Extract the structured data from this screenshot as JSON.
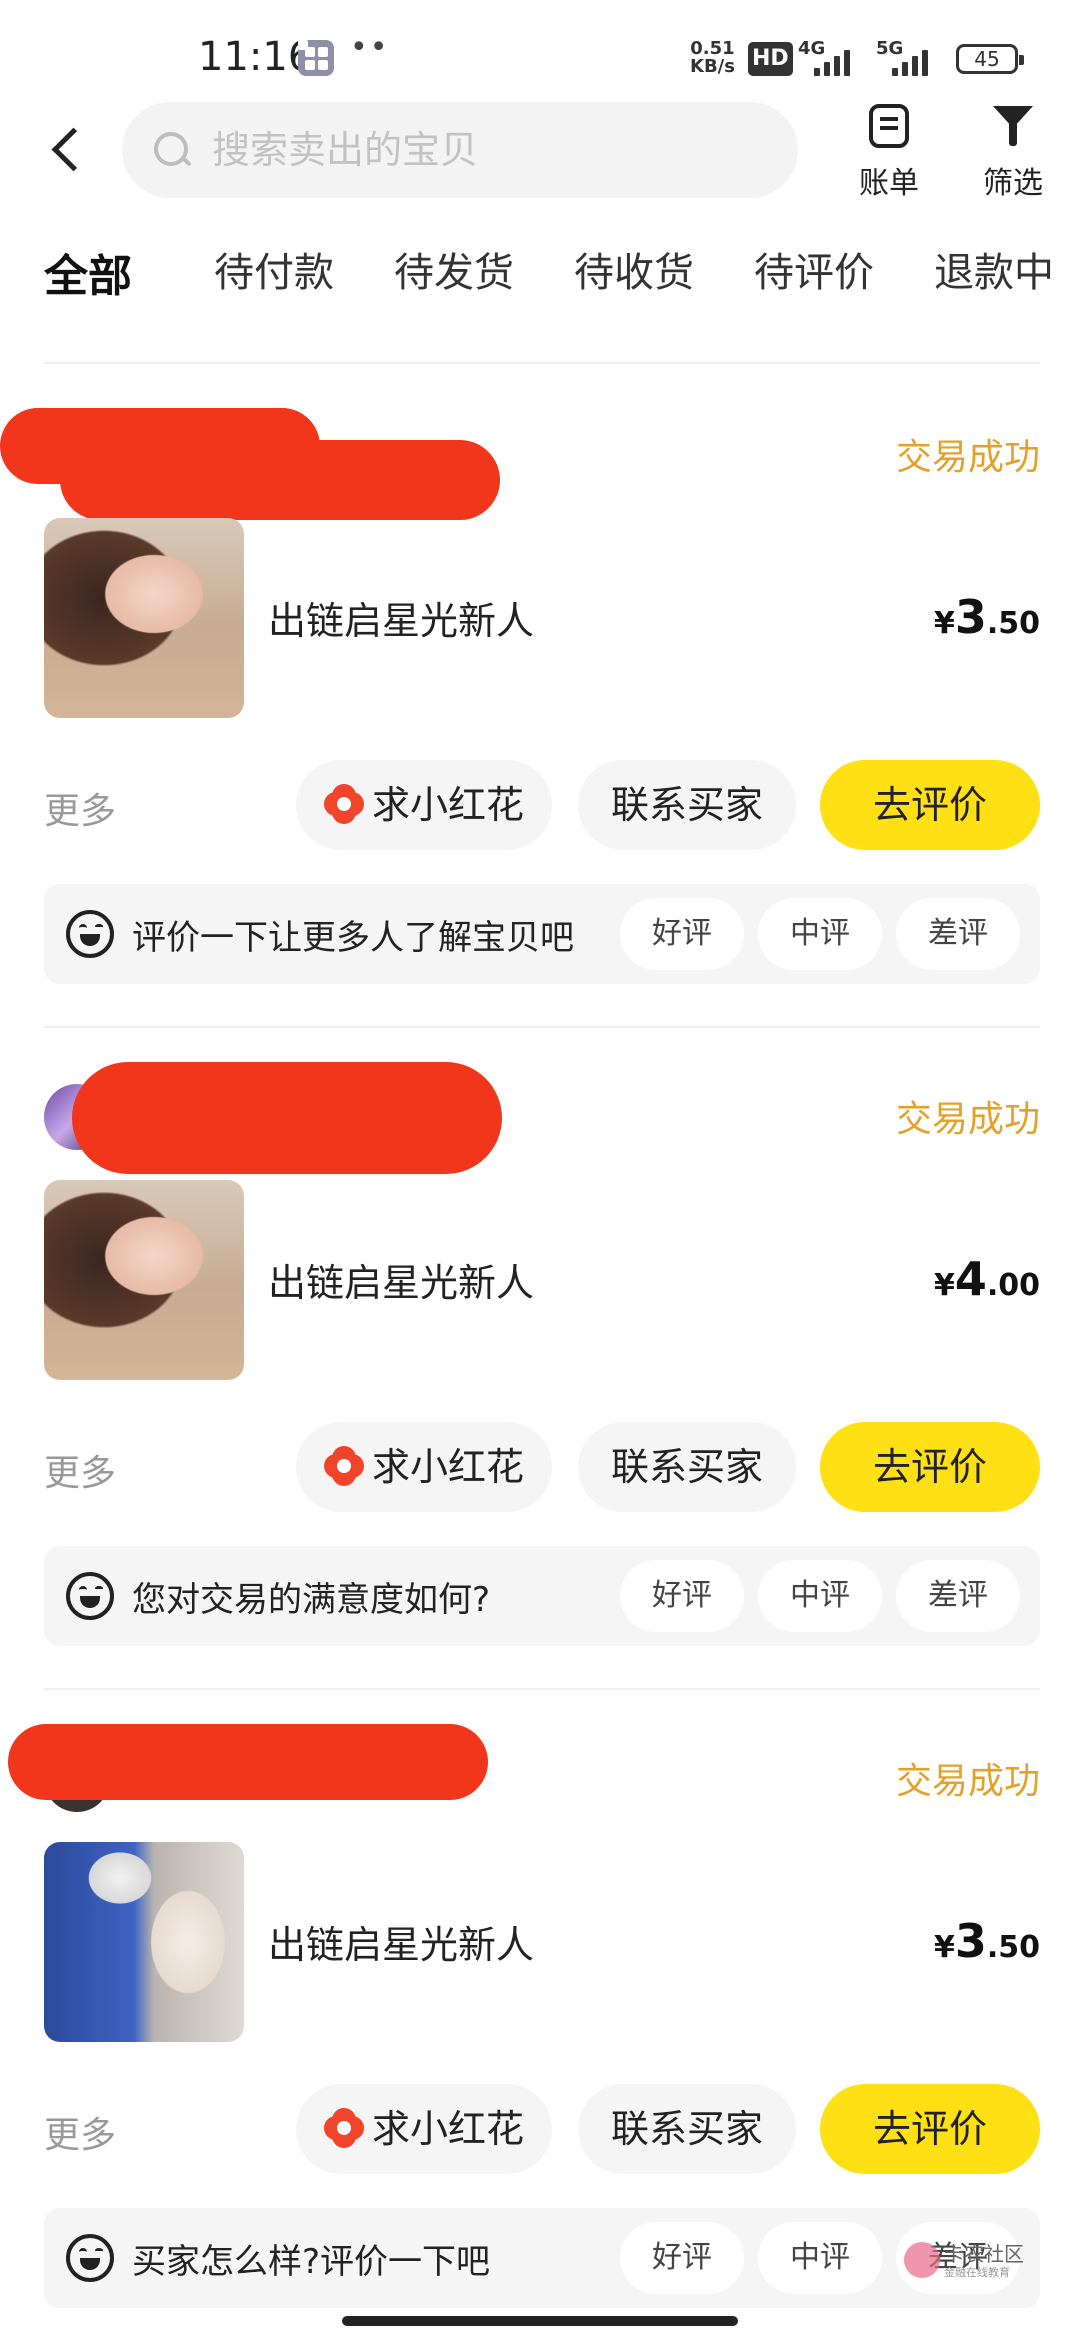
{
  "status_bar": {
    "time": "11:16",
    "dots": "••",
    "speed_value": "0.51",
    "speed_unit": "KB/s",
    "hd": "HD",
    "net1": "4G",
    "net2": "5G",
    "battery": "45"
  },
  "header": {
    "search_placeholder": "搜索卖出的宝贝",
    "bill_label": "账单",
    "filter_label": "筛选"
  },
  "tabs": [
    {
      "label": "全部",
      "active": true
    },
    {
      "label": "待付款"
    },
    {
      "label": "待发货"
    },
    {
      "label": "待收货"
    },
    {
      "label": "待评价"
    },
    {
      "label": "退款中"
    }
  ],
  "orders": [
    {
      "status": "交易成功",
      "title": "出链启星光新人",
      "price_currency": "¥",
      "price_int": "3",
      "price_dec": ".50",
      "more": "更多",
      "flower_btn": "求小红花",
      "contact_btn": "联系买家",
      "review_btn": "去评价",
      "rate_prompt": "评价一下让更多人了解宝贝吧",
      "rate_options": [
        "好评",
        "中评",
        "差评"
      ]
    },
    {
      "status": "交易成功",
      "title": "出链启星光新人",
      "price_currency": "¥",
      "price_int": "4",
      "price_dec": ".00",
      "more": "更多",
      "flower_btn": "求小红花",
      "contact_btn": "联系买家",
      "review_btn": "去评价",
      "rate_prompt": "您对交易的满意度如何?",
      "rate_options": [
        "好评",
        "中评",
        "差评"
      ]
    },
    {
      "status": "交易成功",
      "title": "出链启星光新人",
      "price_currency": "¥",
      "price_int": "3",
      "price_dec": ".50",
      "more": "更多",
      "flower_btn": "求小红花",
      "contact_btn": "联系买家",
      "review_btn": "去评价",
      "rate_prompt": "买家怎么样?评价一下吧",
      "rate_options": [
        "好评",
        "中评",
        "差评"
      ]
    }
  ],
  "watermark": {
    "text": "卡农社区",
    "sub": "金融在线教育"
  },
  "colors": {
    "accent_yellow": "#ffe014",
    "status_orange": "#e3a12a",
    "redaction_red": "#f2361c"
  }
}
